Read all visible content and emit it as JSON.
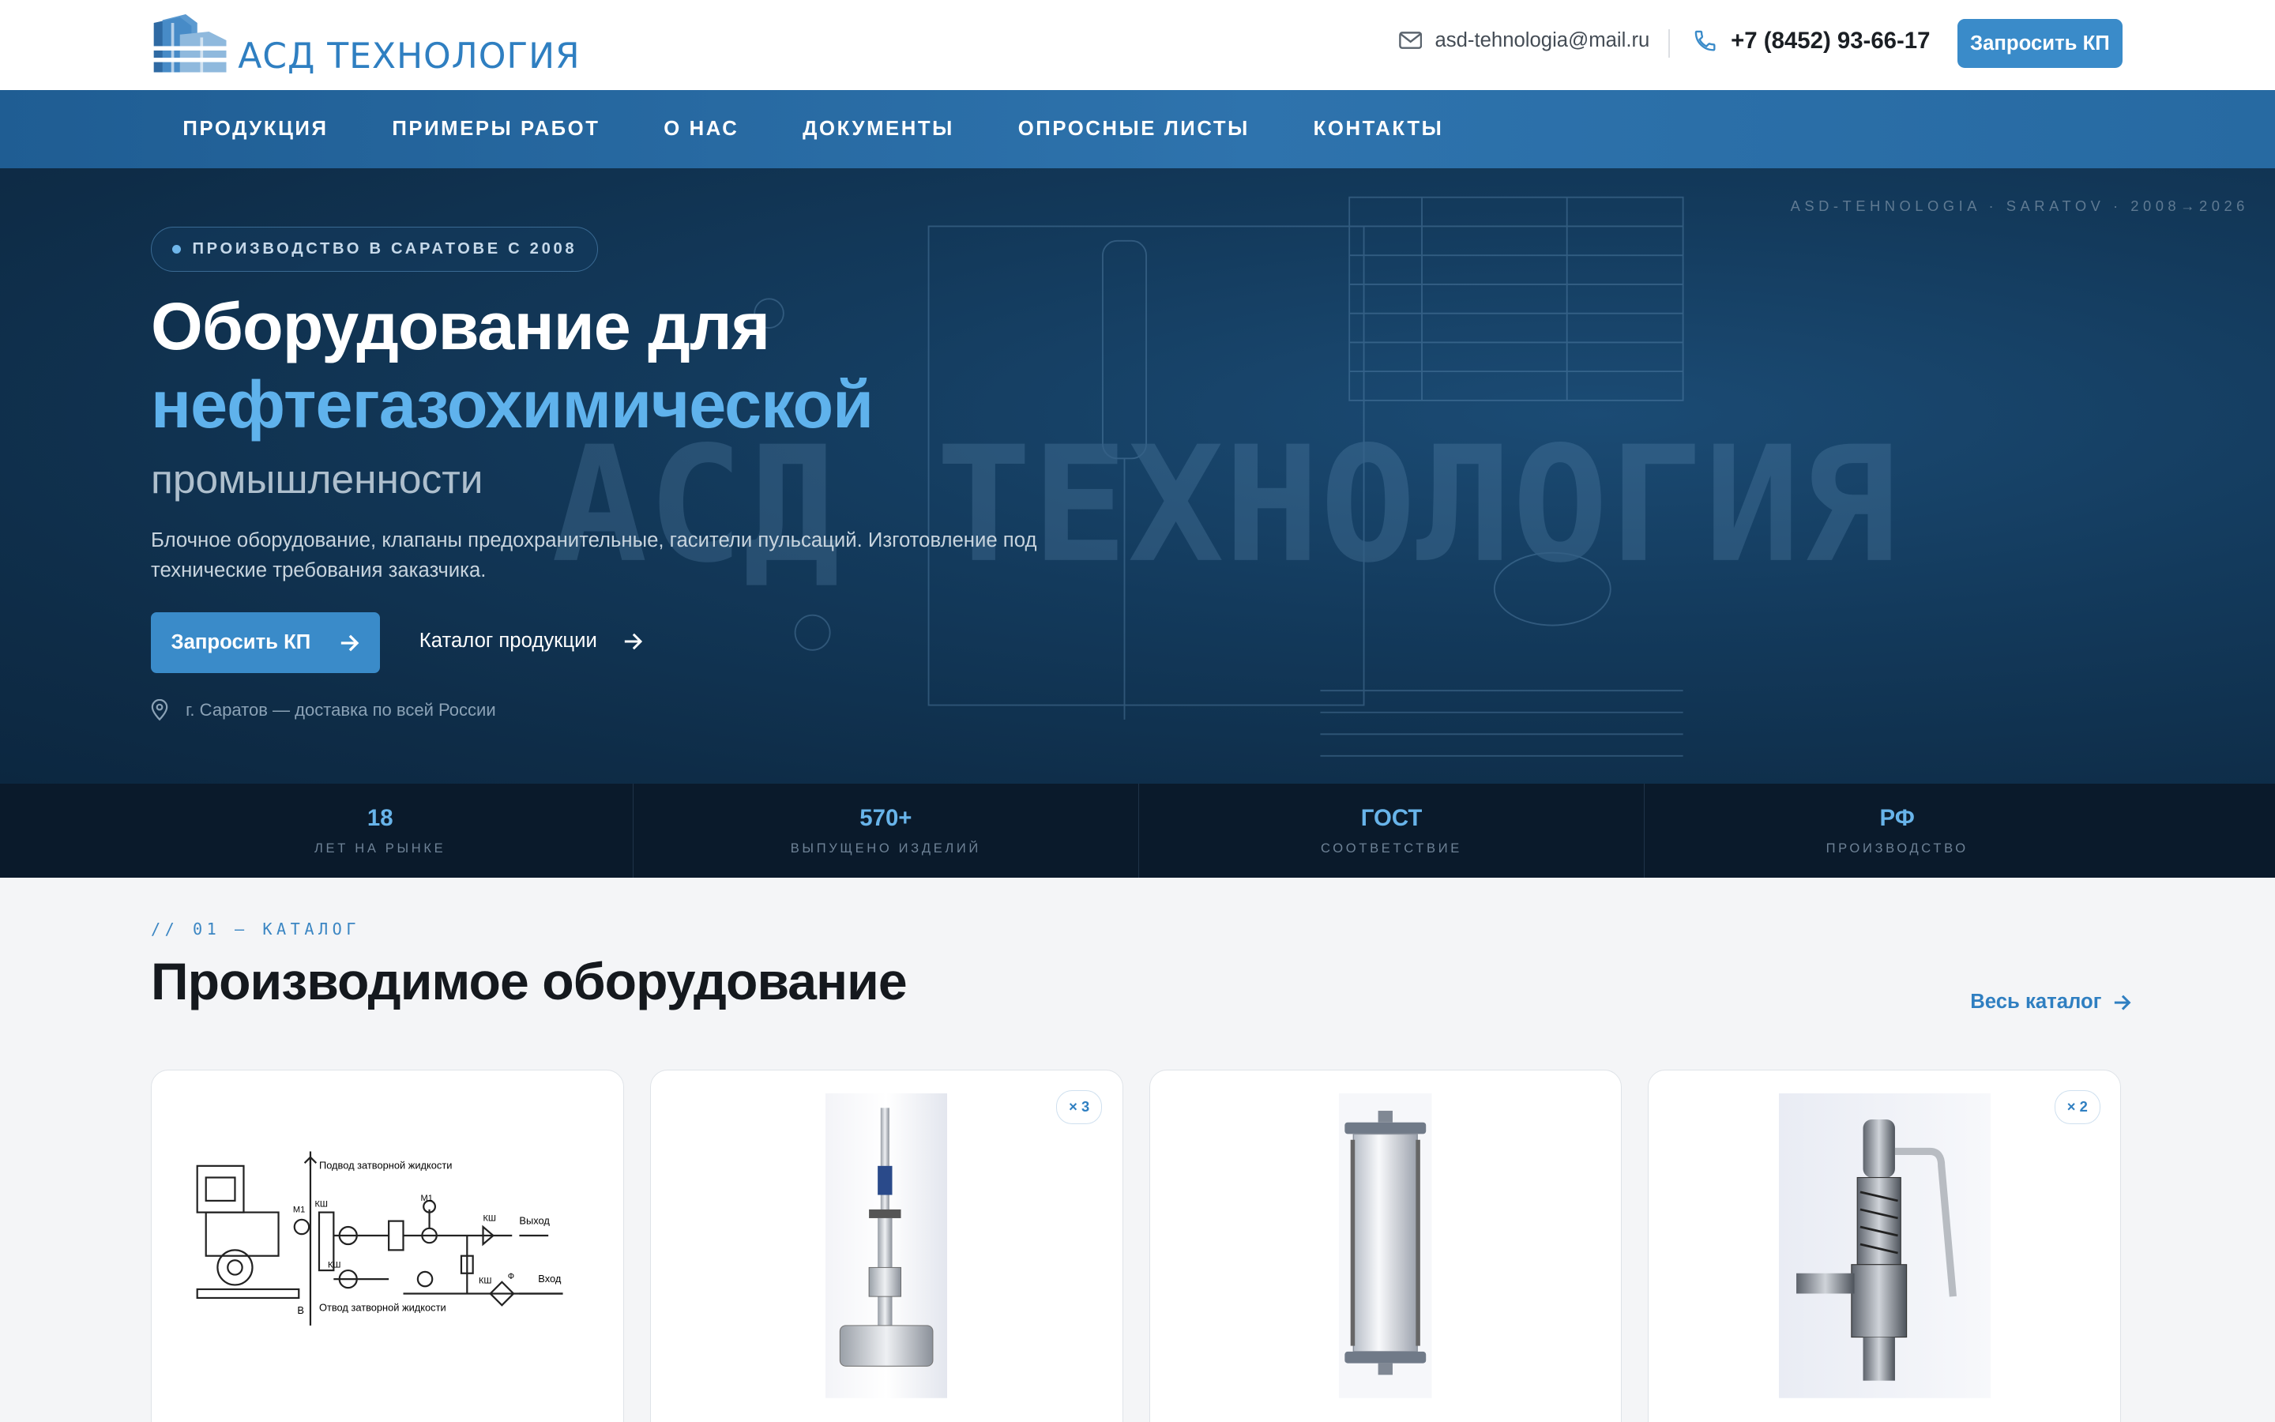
{
  "header": {
    "logo_text": "АСД ТЕХНОЛОГИЯ",
    "email": "asd-tehnologia@mail.ru",
    "phone": "+7 (8452) 93-66-17",
    "cta_label": "Запросить КП"
  },
  "nav": {
    "items": [
      {
        "label": "ПРОДУКЦИЯ"
      },
      {
        "label": "ПРИМЕРЫ РАБОТ"
      },
      {
        "label": "О НАС"
      },
      {
        "label": "ДОКУМЕНТЫ"
      },
      {
        "label": "ОПРОСНЫЕ ЛИСТЫ"
      },
      {
        "label": "КОНТАКТЫ"
      }
    ]
  },
  "hero": {
    "meta": "ASD-TEHNOLOGIA · SARATOV · 2008→2026",
    "badge": "ПРОИЗВОДСТВО В САРАТОВЕ С 2008",
    "title_line1": "Оборудование для",
    "title_line2": "нефтегазохимической",
    "title_line3": "промышленности",
    "lead": "Блочное оборудование, клапаны предохранительные, гасители пульсаций. Изготовление под технические требования заказчика.",
    "primary_button": "Запросить КП",
    "secondary_link": "Каталог продукции",
    "location": "г. Саратов — доставка по всей России",
    "watermark": "АСД ТЕХНОЛОГИЯ"
  },
  "stats": [
    {
      "value": "18",
      "label": "ЛЕТ НА РЫНКЕ"
    },
    {
      "value": "570+",
      "label": "ВЫПУЩЕНО ИЗДЕЛИЙ"
    },
    {
      "value": "ГОСТ",
      "label": "СООТВЕТСТВИЕ"
    },
    {
      "value": "РФ",
      "label": "ПРОИЗВОДСТВО"
    }
  ],
  "catalog": {
    "tag": "// 01 — КАТАЛОГ",
    "title": "Производимое оборудование",
    "all_link": "Весь каталог",
    "cards": [
      {
        "badge": "",
        "diagram_labels": {
          "supply": "Подвод затворной жидкости",
          "drain": "Отвод затворной жидкости",
          "out": "Выход",
          "in": "Вход",
          "m1": "М1",
          "m2": "М1",
          "ksh1": "КШ",
          "ksh2": "КШ",
          "ksh3": "КШ",
          "ksh4": "КШ",
          "f": "Ф",
          "b": "В"
        }
      },
      {
        "badge": "× 3"
      },
      {
        "badge": ""
      },
      {
        "badge": "× 2"
      }
    ]
  },
  "colors": {
    "accent": "#3a8bc9",
    "accent_light": "#5fb2ec",
    "hero_bg": "#133a5c",
    "stats_bg": "#0a1a2b"
  }
}
